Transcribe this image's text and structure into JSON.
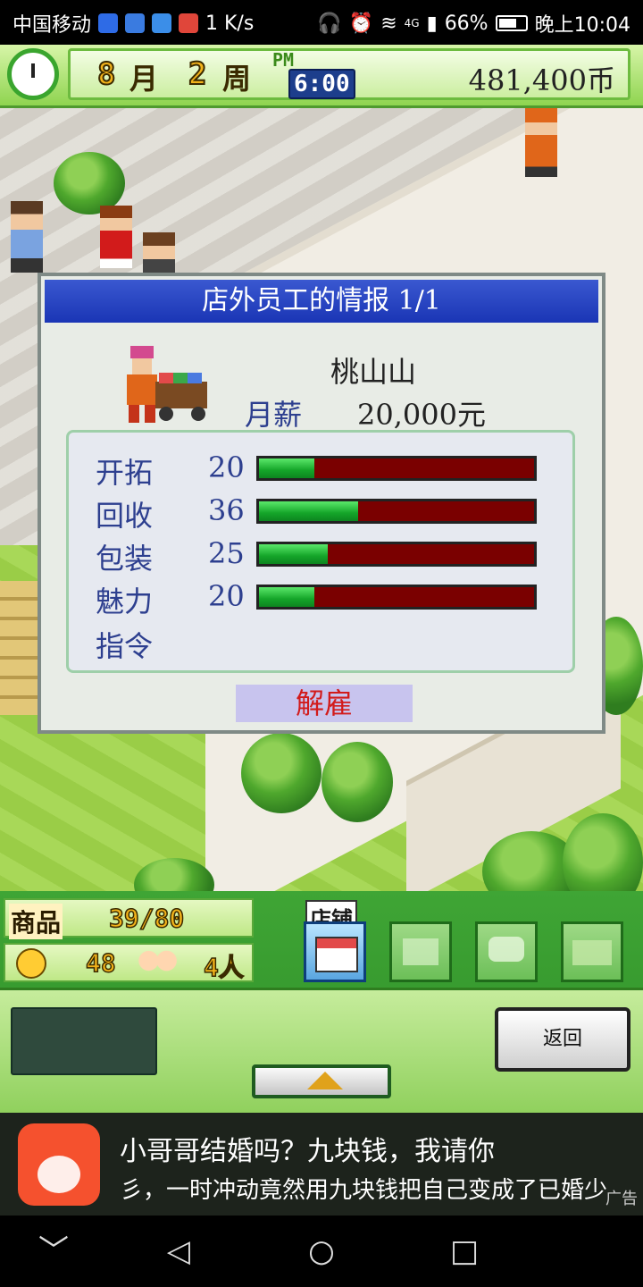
{
  "status_bar": {
    "carrier": "中国移动",
    "net_speed": "1 K/s",
    "signal_label": "4G",
    "battery": "66%",
    "time": "晚上10:04"
  },
  "hud": {
    "month_num": "8",
    "month_label": "月",
    "week_num": "2",
    "week_label": "周",
    "ampm": "PM",
    "time": "6:00",
    "money": "481,400币"
  },
  "dialog": {
    "title": "店外员工的情报 1/1",
    "employee_name": "桃山山",
    "salary_label": "月薪",
    "salary_value": "20,000元",
    "max_stat": 100,
    "stats": [
      {
        "label": "开拓",
        "value": "20",
        "level": 20
      },
      {
        "label": "回收",
        "value": "36",
        "level": 36
      },
      {
        "label": "包装",
        "value": "25",
        "level": 25
      },
      {
        "label": "魅力",
        "value": "20",
        "level": 20
      }
    ],
    "command_label": "指令",
    "dismiss_label": "解雇"
  },
  "bottom_hud": {
    "goods_label": "商品",
    "goods_value": "39/80",
    "satisfaction_value": "48",
    "people_value": "4人",
    "shop_label": "店铺",
    "back_label": "返回"
  },
  "ad": {
    "title": "小哥哥结婚吗？九块钱，我请你",
    "subtitle": "彡，一时冲动竟然用九块钱把自己变成了已婚少",
    "tag": "广告"
  },
  "nav": {
    "back": "﹀",
    "home": "○",
    "recent": "□",
    "triangle": "◁"
  }
}
